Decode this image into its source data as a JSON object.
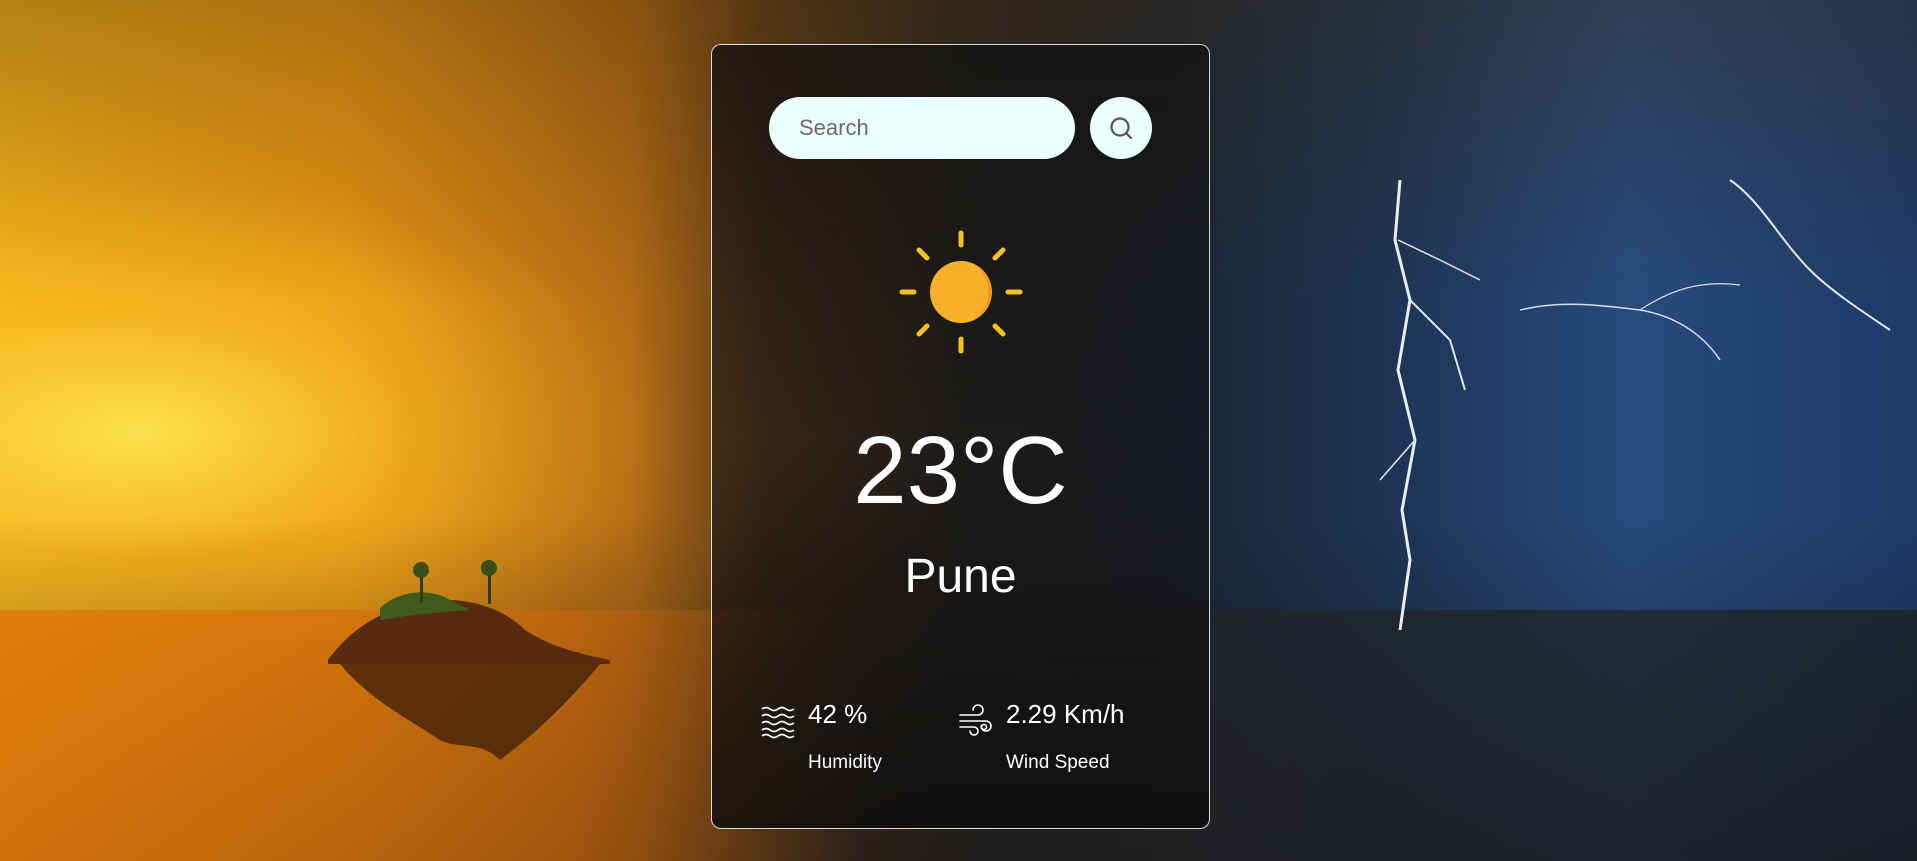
{
  "search": {
    "placeholder": "Search",
    "button_icon": "search-icon"
  },
  "weather": {
    "icon": "sun-icon",
    "temperature": "23°C",
    "city": "Pune",
    "humidity": {
      "value": "42 %",
      "label": "Humidity",
      "icon": "humidity-waves-icon"
    },
    "wind": {
      "value": "2.29 Km/h",
      "label": "Wind Speed",
      "icon": "wind-icon"
    }
  },
  "colors": {
    "sun": "#fbb02c",
    "sun_rays": "#f7c21c",
    "input_bg": "#ebfffc",
    "text": "#ffffff"
  }
}
